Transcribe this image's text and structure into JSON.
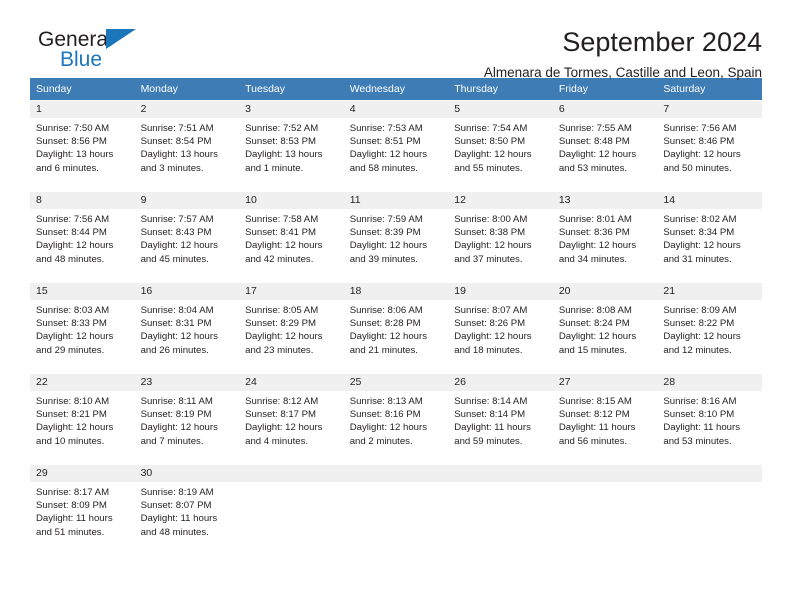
{
  "brand": {
    "name_dark": "General",
    "name_blue": "Blue",
    "accent_color": "#1c76bc"
  },
  "header": {
    "title": "September 2024",
    "subtitle": "Almenara de Tormes, Castille and Leon, Spain"
  },
  "calendar": {
    "header_bg": "#3d7cb5",
    "daynum_bg": "#f0f0f0",
    "row_divider": "#2f6ba6",
    "weekdays": [
      "Sunday",
      "Monday",
      "Tuesday",
      "Wednesday",
      "Thursday",
      "Friday",
      "Saturday"
    ],
    "weeks": [
      [
        {
          "day": "1",
          "sunrise": "Sunrise: 7:50 AM",
          "sunset": "Sunset: 8:56 PM",
          "daylight": "Daylight: 13 hours and 6 minutes."
        },
        {
          "day": "2",
          "sunrise": "Sunrise: 7:51 AM",
          "sunset": "Sunset: 8:54 PM",
          "daylight": "Daylight: 13 hours and 3 minutes."
        },
        {
          "day": "3",
          "sunrise": "Sunrise: 7:52 AM",
          "sunset": "Sunset: 8:53 PM",
          "daylight": "Daylight: 13 hours and 1 minute."
        },
        {
          "day": "4",
          "sunrise": "Sunrise: 7:53 AM",
          "sunset": "Sunset: 8:51 PM",
          "daylight": "Daylight: 12 hours and 58 minutes."
        },
        {
          "day": "5",
          "sunrise": "Sunrise: 7:54 AM",
          "sunset": "Sunset: 8:50 PM",
          "daylight": "Daylight: 12 hours and 55 minutes."
        },
        {
          "day": "6",
          "sunrise": "Sunrise: 7:55 AM",
          "sunset": "Sunset: 8:48 PM",
          "daylight": "Daylight: 12 hours and 53 minutes."
        },
        {
          "day": "7",
          "sunrise": "Sunrise: 7:56 AM",
          "sunset": "Sunset: 8:46 PM",
          "daylight": "Daylight: 12 hours and 50 minutes."
        }
      ],
      [
        {
          "day": "8",
          "sunrise": "Sunrise: 7:56 AM",
          "sunset": "Sunset: 8:44 PM",
          "daylight": "Daylight: 12 hours and 48 minutes."
        },
        {
          "day": "9",
          "sunrise": "Sunrise: 7:57 AM",
          "sunset": "Sunset: 8:43 PM",
          "daylight": "Daylight: 12 hours and 45 minutes."
        },
        {
          "day": "10",
          "sunrise": "Sunrise: 7:58 AM",
          "sunset": "Sunset: 8:41 PM",
          "daylight": "Daylight: 12 hours and 42 minutes."
        },
        {
          "day": "11",
          "sunrise": "Sunrise: 7:59 AM",
          "sunset": "Sunset: 8:39 PM",
          "daylight": "Daylight: 12 hours and 39 minutes."
        },
        {
          "day": "12",
          "sunrise": "Sunrise: 8:00 AM",
          "sunset": "Sunset: 8:38 PM",
          "daylight": "Daylight: 12 hours and 37 minutes."
        },
        {
          "day": "13",
          "sunrise": "Sunrise: 8:01 AM",
          "sunset": "Sunset: 8:36 PM",
          "daylight": "Daylight: 12 hours and 34 minutes."
        },
        {
          "day": "14",
          "sunrise": "Sunrise: 8:02 AM",
          "sunset": "Sunset: 8:34 PM",
          "daylight": "Daylight: 12 hours and 31 minutes."
        }
      ],
      [
        {
          "day": "15",
          "sunrise": "Sunrise: 8:03 AM",
          "sunset": "Sunset: 8:33 PM",
          "daylight": "Daylight: 12 hours and 29 minutes."
        },
        {
          "day": "16",
          "sunrise": "Sunrise: 8:04 AM",
          "sunset": "Sunset: 8:31 PM",
          "daylight": "Daylight: 12 hours and 26 minutes."
        },
        {
          "day": "17",
          "sunrise": "Sunrise: 8:05 AM",
          "sunset": "Sunset: 8:29 PM",
          "daylight": "Daylight: 12 hours and 23 minutes."
        },
        {
          "day": "18",
          "sunrise": "Sunrise: 8:06 AM",
          "sunset": "Sunset: 8:28 PM",
          "daylight": "Daylight: 12 hours and 21 minutes."
        },
        {
          "day": "19",
          "sunrise": "Sunrise: 8:07 AM",
          "sunset": "Sunset: 8:26 PM",
          "daylight": "Daylight: 12 hours and 18 minutes."
        },
        {
          "day": "20",
          "sunrise": "Sunrise: 8:08 AM",
          "sunset": "Sunset: 8:24 PM",
          "daylight": "Daylight: 12 hours and 15 minutes."
        },
        {
          "day": "21",
          "sunrise": "Sunrise: 8:09 AM",
          "sunset": "Sunset: 8:22 PM",
          "daylight": "Daylight: 12 hours and 12 minutes."
        }
      ],
      [
        {
          "day": "22",
          "sunrise": "Sunrise: 8:10 AM",
          "sunset": "Sunset: 8:21 PM",
          "daylight": "Daylight: 12 hours and 10 minutes."
        },
        {
          "day": "23",
          "sunrise": "Sunrise: 8:11 AM",
          "sunset": "Sunset: 8:19 PM",
          "daylight": "Daylight: 12 hours and 7 minutes."
        },
        {
          "day": "24",
          "sunrise": "Sunrise: 8:12 AM",
          "sunset": "Sunset: 8:17 PM",
          "daylight": "Daylight: 12 hours and 4 minutes."
        },
        {
          "day": "25",
          "sunrise": "Sunrise: 8:13 AM",
          "sunset": "Sunset: 8:16 PM",
          "daylight": "Daylight: 12 hours and 2 minutes."
        },
        {
          "day": "26",
          "sunrise": "Sunrise: 8:14 AM",
          "sunset": "Sunset: 8:14 PM",
          "daylight": "Daylight: 11 hours and 59 minutes."
        },
        {
          "day": "27",
          "sunrise": "Sunrise: 8:15 AM",
          "sunset": "Sunset: 8:12 PM",
          "daylight": "Daylight: 11 hours and 56 minutes."
        },
        {
          "day": "28",
          "sunrise": "Sunrise: 8:16 AM",
          "sunset": "Sunset: 8:10 PM",
          "daylight": "Daylight: 11 hours and 53 minutes."
        }
      ],
      [
        {
          "day": "29",
          "sunrise": "Sunrise: 8:17 AM",
          "sunset": "Sunset: 8:09 PM",
          "daylight": "Daylight: 11 hours and 51 minutes."
        },
        {
          "day": "30",
          "sunrise": "Sunrise: 8:19 AM",
          "sunset": "Sunset: 8:07 PM",
          "daylight": "Daylight: 11 hours and 48 minutes."
        },
        {
          "day": "",
          "sunrise": "",
          "sunset": "",
          "daylight": ""
        },
        {
          "day": "",
          "sunrise": "",
          "sunset": "",
          "daylight": ""
        },
        {
          "day": "",
          "sunrise": "",
          "sunset": "",
          "daylight": ""
        },
        {
          "day": "",
          "sunrise": "",
          "sunset": "",
          "daylight": ""
        },
        {
          "day": "",
          "sunrise": "",
          "sunset": "",
          "daylight": ""
        }
      ]
    ]
  }
}
